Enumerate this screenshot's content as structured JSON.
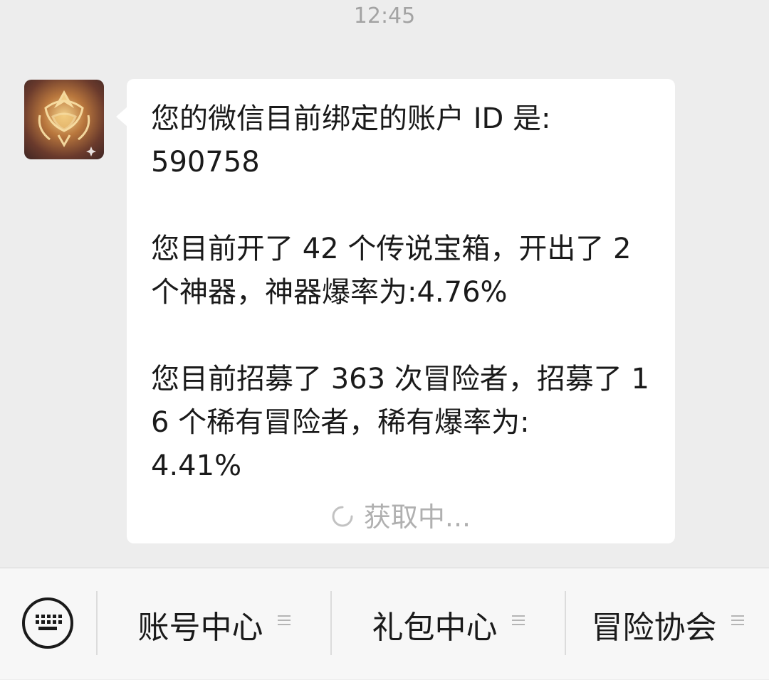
{
  "chat": {
    "timestamp": "12:45",
    "message": {
      "text": "您的微信目前绑定的账户 ID 是:\n590758\n\n您目前开了 42 个传说宝箱，开出了 2 个神器，神器爆率为:4.76%\n\n您目前招募了 363 次冒险者，招募了 16 个稀有冒险者，稀有爆率为:\n4.41%",
      "status": "获取中..."
    },
    "avatar_icon": "golden-emblem-avatar"
  },
  "menu": {
    "keyboard_icon": "keyboard-icon",
    "items": [
      {
        "label": "账号中心"
      },
      {
        "label": "礼包中心"
      },
      {
        "label": "冒险协会"
      }
    ]
  },
  "colors": {
    "background": "#ededed",
    "bubble": "#ffffff",
    "menu_bar": "#f7f7f7"
  }
}
